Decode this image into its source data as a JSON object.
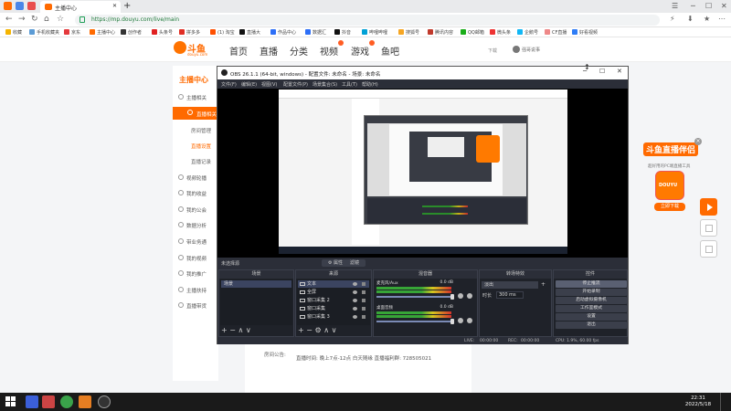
{
  "browser": {
    "tab_title": "主播中心",
    "url": "https://mp.douyu.com/live/main",
    "bookmarks": [
      "收藏",
      "手机收藏夹",
      "京东",
      "主播中心",
      "创作者",
      "头条号",
      "拼多多",
      "(1) 淘宝",
      "直播大",
      "作品中心",
      "数据汇",
      "抖音",
      "哔哩哔哩",
      "搜狐号",
      "腾讯内容",
      "QQ邮箱",
      "微头条",
      "企鹅号",
      "CF直播",
      "好看视频"
    ],
    "new_tab": "+"
  },
  "douyu": {
    "logo_text": "斗鱼",
    "logo_sub": "douyu.com",
    "nav": [
      "首页",
      "直播",
      "分类",
      "视频",
      "游戏",
      "鱼吧"
    ],
    "download": "下载",
    "username": "强哥说事",
    "sidebar_title": "主播中心",
    "sidebar_items": [
      {
        "label": "主播相关",
        "icon": "user-icon"
      },
      {
        "label": "直播相关",
        "icon": "play-icon"
      },
      {
        "label": "房间管理",
        "icon": ""
      },
      {
        "label": "直播设置",
        "icon": ""
      },
      {
        "label": "直播记录",
        "icon": ""
      },
      {
        "label": "视频轮播",
        "icon": "video-icon"
      },
      {
        "label": "我的收益",
        "icon": "coin-icon"
      },
      {
        "label": "我的公会",
        "icon": "group-icon"
      },
      {
        "label": "数据分析",
        "icon": "chart-icon"
      },
      {
        "label": "带业务通",
        "icon": "briefcase-icon"
      },
      {
        "label": "我的视频",
        "icon": "film-icon"
      },
      {
        "label": "我的推广",
        "icon": "megaphone-icon"
      },
      {
        "label": "主播扶持",
        "icon": "heart-icon"
      },
      {
        "label": "直播带货",
        "icon": "cart-icon"
      }
    ],
    "notice_label": "房间公告:",
    "notice": "直播时间: 晚上7点-12点 白天随缘 直播福利群: 728505021",
    "promo_title": "斗鱼直播伴侣",
    "promo_sub": "超好用的PC端直播工具",
    "promo_app": "DOUYU",
    "promo_btn": "立即下载"
  },
  "obs": {
    "title": "OBS 26.1.1 (64-bit, windows) - 配置文件: 未命名 - 场景: 未命名",
    "menu": [
      "文件(F)",
      "编辑(E)",
      "视图(V)",
      "配置文件(P)",
      "场景集合(S)",
      "工具(T)",
      "帮助(H)"
    ],
    "scene_bar_label": "未选择源",
    "properties_btn": "属性",
    "filters_btn": "滤镜",
    "docks": {
      "scenes_title": "场景",
      "sources_title": "来源",
      "mixer_title": "混音器",
      "transitions_title": "转场特效",
      "controls_title": "控件"
    },
    "scenes": [
      "场景"
    ],
    "sources": [
      "文本",
      "全屏",
      "窗口采集 2",
      "窗口采集",
      "窗口采集 3"
    ],
    "mixer": [
      {
        "label": "麦克风/Aux",
        "value": "0.0 dB"
      },
      {
        "label": "桌面音频",
        "value": "0.0 dB"
      }
    ],
    "transition": "淡出",
    "duration_label": "时长",
    "duration": "300 ms",
    "controls": [
      "停止推流",
      "开始录制",
      "启动虚拟摄像机",
      "工作室模式",
      "设置",
      "退出"
    ],
    "status": {
      "live_label": "LIVE:",
      "live": "00:00:00",
      "rec_label": "REC:",
      "rec": "00:00:00",
      "cpu": "CPU: 1.9%, 60.00 fps"
    }
  },
  "taskbar": {
    "time": "22:31",
    "date": "2022/5/18"
  },
  "colors": {
    "douyu_orange": "#ff6a00",
    "obs_bg": "#2b2e38",
    "selected_row": "#3b4460"
  }
}
